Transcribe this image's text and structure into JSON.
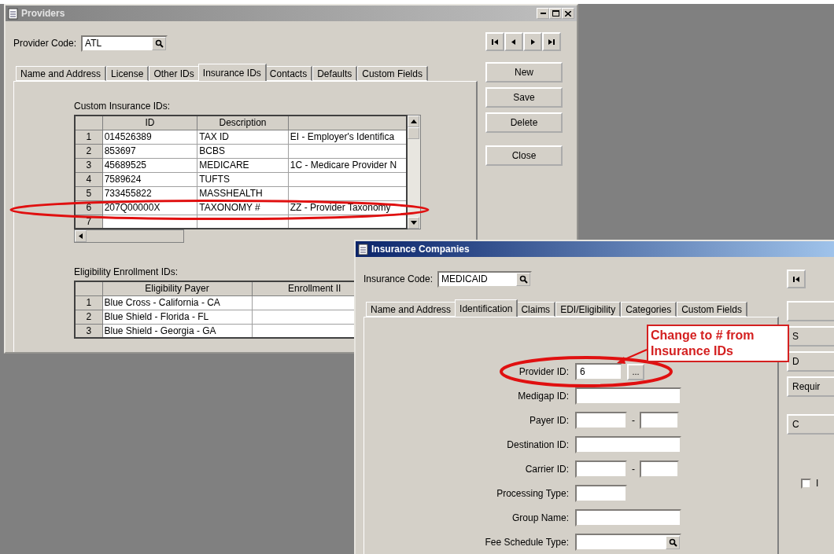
{
  "providers_window": {
    "title": "Providers",
    "code_label": "Provider Code:",
    "code_value": "ATL",
    "tabs": [
      {
        "label": "Name and Address",
        "selected": false
      },
      {
        "label": "License",
        "selected": false
      },
      {
        "label": "Other IDs",
        "selected": false
      },
      {
        "label": "Insurance IDs",
        "selected": true
      },
      {
        "label": "Contacts",
        "selected": false
      },
      {
        "label": "Defaults",
        "selected": false
      },
      {
        "label": "Custom Fields",
        "selected": false
      }
    ],
    "custom_ids": {
      "label": "Custom Insurance IDs:",
      "columns": [
        "ID",
        "Description"
      ],
      "rows": [
        {
          "number": "1",
          "cells": [
            "014526389",
            "TAX ID",
            "EI - Employer's Identifica"
          ]
        },
        {
          "number": "2",
          "cells": [
            "853697",
            "BCBS"
          ]
        },
        {
          "number": "3",
          "cells": [
            "45689525",
            "MEDICARE",
            "1C - Medicare Provider N"
          ]
        },
        {
          "number": "4",
          "cells": [
            "7589624",
            "TUFTS"
          ]
        },
        {
          "number": "5",
          "cells": [
            "733455822",
            "MASSHEALTH"
          ]
        },
        {
          "number": "6",
          "cells": [
            "207Q00000X",
            "TAXONOMY #",
            "ZZ - Provider Taxonomy"
          ]
        },
        {
          "number": "7"
        }
      ]
    },
    "eligibility": {
      "label": "Eligibility Enrollment IDs:",
      "columns": [
        "Eligibility Payer",
        "Enrollment II"
      ],
      "rows": [
        {
          "number": "1",
          "cells": [
            "Blue Cross - California - CA"
          ]
        },
        {
          "number": "2",
          "cells": [
            "Blue Shield - Florida - FL"
          ]
        },
        {
          "number": "3",
          "cells": [
            "Blue Shield - Georgia - GA"
          ]
        }
      ]
    },
    "buttons": [
      "New",
      "Save",
      "Delete",
      "Close"
    ]
  },
  "insurance_window": {
    "title": "Insurance Companies",
    "code_label": "Insurance Code:",
    "code_value": "MEDICAID",
    "tabs": [
      {
        "label": "Name and Address",
        "selected": false
      },
      {
        "label": "Identification",
        "selected": true
      },
      {
        "label": "Claims",
        "selected": false
      },
      {
        "label": "EDI/Eligibility",
        "selected": false
      },
      {
        "label": "Categories",
        "selected": false
      },
      {
        "label": "Custom Fields",
        "selected": false
      }
    ],
    "fields": [
      {
        "label": "Provider ID:",
        "kind": "browse",
        "value": "6",
        "button": "..."
      },
      {
        "label": "Medigap ID:",
        "kind": "wide"
      },
      {
        "label": "Payer ID:",
        "kind": "pair",
        "separator": "-"
      },
      {
        "label": "Destination ID:",
        "kind": "wide"
      },
      {
        "label": "Carrier ID:",
        "kind": "pair",
        "separator": "-"
      },
      {
        "label": "Processing Type:",
        "kind": "short"
      },
      {
        "label": "Group Name:",
        "kind": "wide"
      },
      {
        "label": "Fee Schedule Type:",
        "kind": "lookup"
      }
    ],
    "buttons": [
      {
        "kind": "blank"
      },
      {
        "kind": "text",
        "label": "S"
      },
      {
        "kind": "text",
        "label": "D"
      },
      {
        "kind": "text",
        "label": "Requir"
      },
      {
        "kind": "text",
        "label": "C"
      }
    ],
    "checkbox": {
      "label": "I",
      "checked": false
    }
  },
  "annotation": {
    "text": "Change to # from Insurance IDs"
  }
}
